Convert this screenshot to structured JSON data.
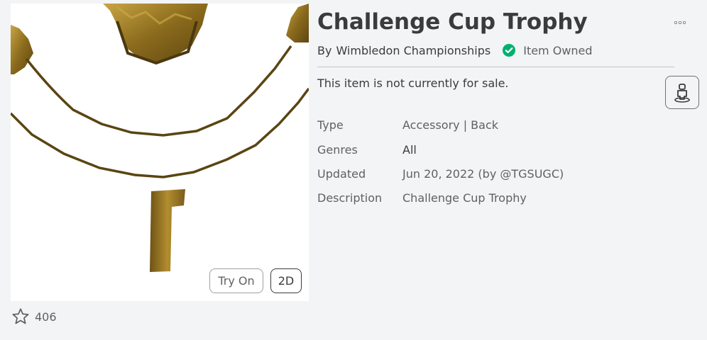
{
  "item": {
    "title": "Challenge Cup Trophy",
    "by_label": "By",
    "creator": "Wimbledon Championships",
    "owned_label": "Item Owned",
    "sale_status": "This item is not currently for sale."
  },
  "thumbnail": {
    "try_on_label": "Try On",
    "view_2d_label": "2D"
  },
  "favorites": {
    "count": "406"
  },
  "details": {
    "type_label": "Type",
    "type_value": "Accessory | Back",
    "genres_label": "Genres",
    "genres_value": "All",
    "updated_label": "Updated",
    "updated_value": "Jun 20, 2022 (by @TGSUGC)",
    "description_label": "Description",
    "description_value": "Challenge Cup Trophy"
  },
  "colors": {
    "page_bg": "#f2f4f5",
    "text_primary": "#393b3d",
    "text_secondary": "#606162",
    "owned_green": "#00b06f",
    "trophy_gold": "#a8862b"
  },
  "icons": {
    "more": "more-horizontal-icon",
    "owned": "check-circle-icon",
    "avatar": "avatar-preview-icon",
    "favorite": "star-outline-icon"
  }
}
